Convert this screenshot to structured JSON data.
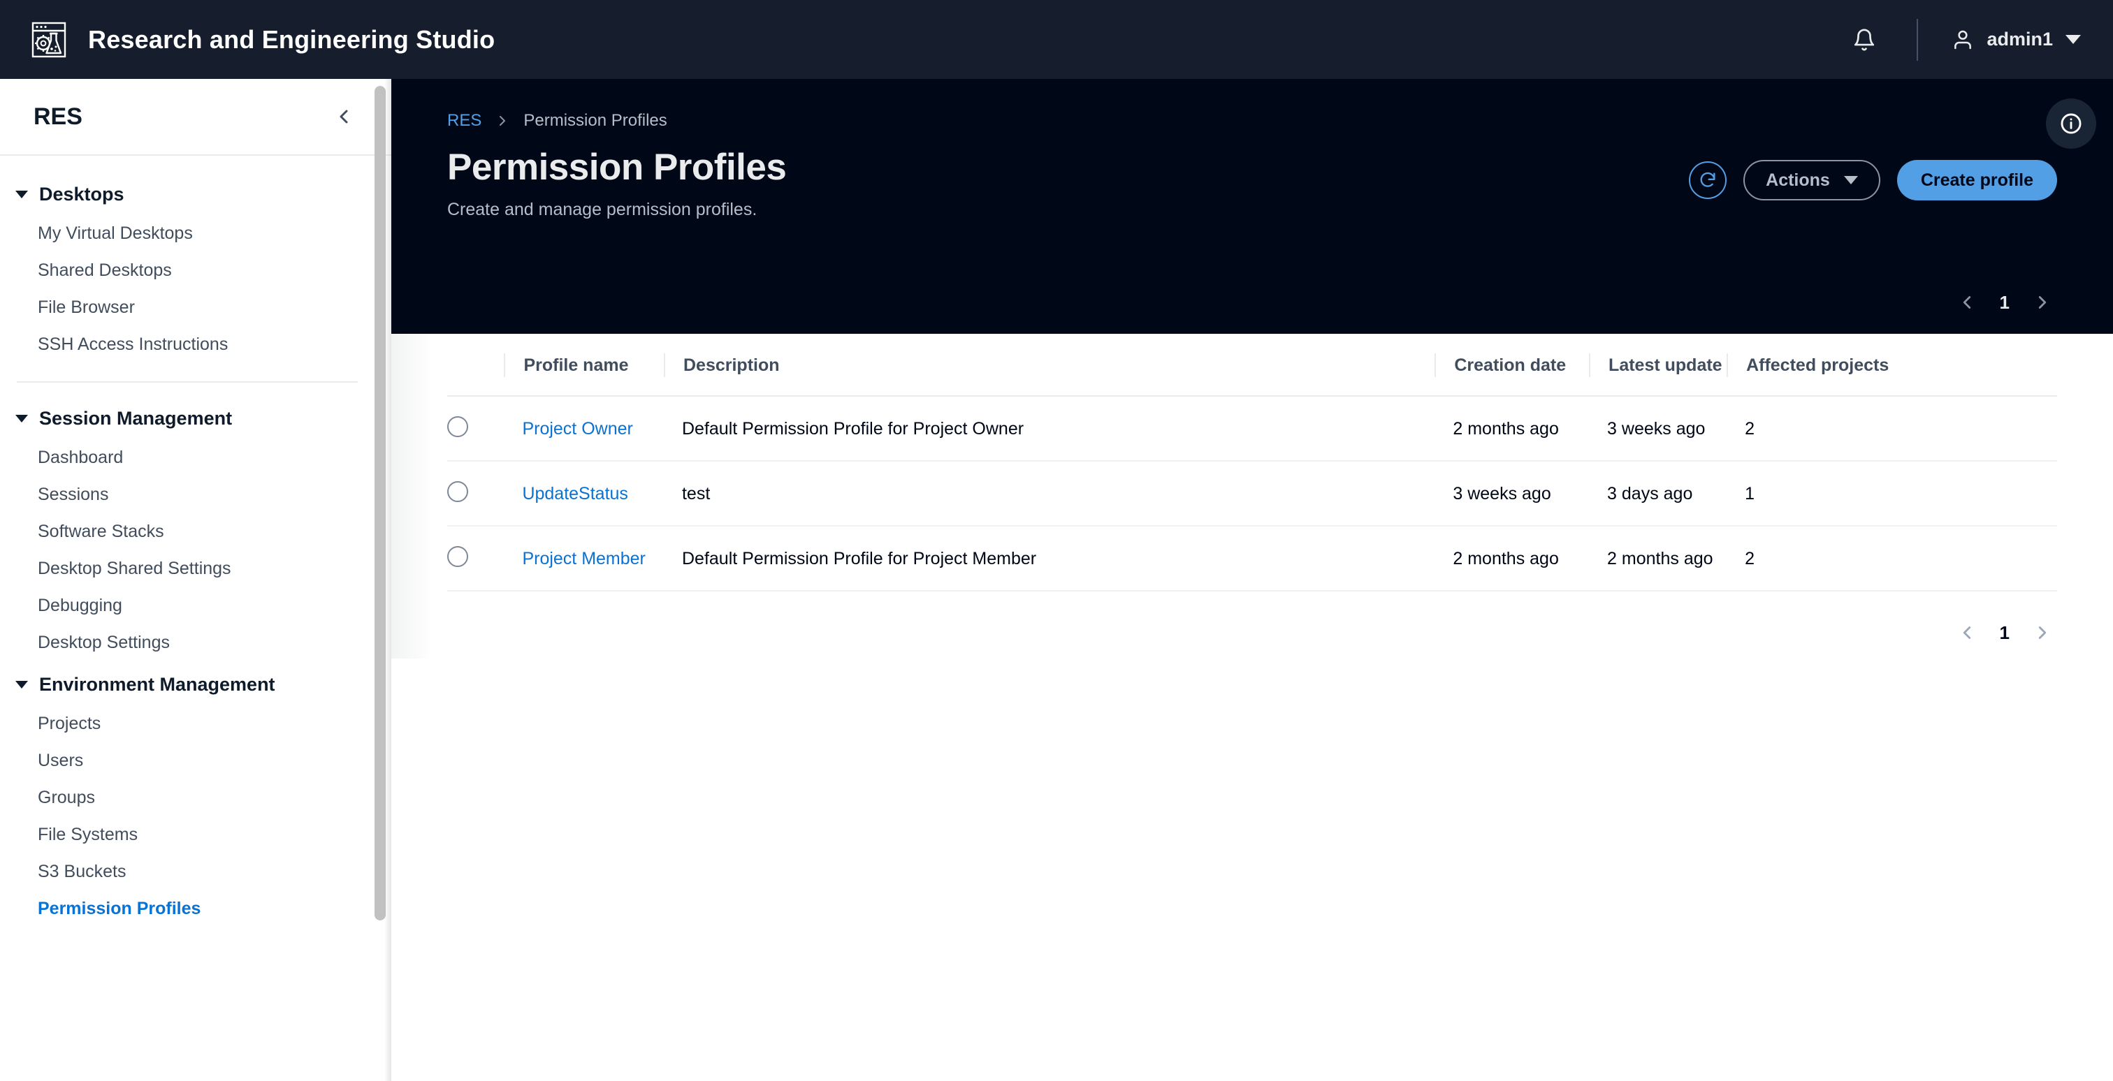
{
  "topbar": {
    "brand_title": "Research and Engineering Studio",
    "logo_icon": "flask-gear-window-logo-icon",
    "notifications_icon": "bell-icon",
    "user_icon": "user-icon",
    "user_name": "admin1",
    "user_caret_icon": "caret-down-icon"
  },
  "sidebar": {
    "title": "RES",
    "collapse_icon": "chevron-left-icon",
    "groups": [
      {
        "label": "Desktops",
        "expanded_icon": "triangle-down-icon",
        "items": [
          {
            "label": "My Virtual Desktops",
            "active": false
          },
          {
            "label": "Shared Desktops",
            "active": false
          },
          {
            "label": "File Browser",
            "active": false
          },
          {
            "label": "SSH Access Instructions",
            "active": false
          }
        ]
      },
      {
        "label": "Session Management",
        "expanded_icon": "triangle-down-icon",
        "items": [
          {
            "label": "Dashboard",
            "active": false
          },
          {
            "label": "Sessions",
            "active": false
          },
          {
            "label": "Software Stacks",
            "active": false
          },
          {
            "label": "Desktop Shared Settings",
            "active": false
          },
          {
            "label": "Debugging",
            "active": false
          },
          {
            "label": "Desktop Settings",
            "active": false
          }
        ]
      },
      {
        "label": "Environment Management",
        "expanded_icon": "triangle-down-icon",
        "items": [
          {
            "label": "Projects",
            "active": false
          },
          {
            "label": "Users",
            "active": false
          },
          {
            "label": "Groups",
            "active": false
          },
          {
            "label": "File Systems",
            "active": false
          },
          {
            "label": "S3 Buckets",
            "active": false
          },
          {
            "label": "Permission Profiles",
            "active": true
          }
        ]
      }
    ]
  },
  "main": {
    "breadcrumb": {
      "root": "RES",
      "separator_icon": "chevron-right-icon",
      "current": "Permission Profiles"
    },
    "page_title": "Permission Profiles",
    "page_subtitle": "Create and manage permission profiles.",
    "toolbar": {
      "refresh_icon": "refresh-icon",
      "refresh_label": "",
      "actions_label": "Actions",
      "actions_caret_icon": "caret-down-icon",
      "create_label": "Create profile"
    },
    "info_icon": "info-circle-icon",
    "pagination_top": {
      "prev_icon": "chevron-left-icon",
      "page": "1",
      "next_icon": "chevron-right-icon"
    },
    "pagination_bottom": {
      "prev_icon": "chevron-left-icon",
      "page": "1",
      "next_icon": "chevron-right-icon"
    },
    "table": {
      "columns": [
        "Profile name",
        "Description",
        "Creation date",
        "Latest update",
        "Affected projects"
      ],
      "rows": [
        {
          "selected": false,
          "profile_name": "Project Owner",
          "description": "Default Permission Profile for Project Owner",
          "creation_date": "2 months ago",
          "latest_update": "3 weeks ago",
          "affected_projects": "2"
        },
        {
          "selected": false,
          "profile_name": "UpdateStatus",
          "description": "test",
          "creation_date": "3 weeks ago",
          "latest_update": "3 days ago",
          "affected_projects": "1"
        },
        {
          "selected": false,
          "profile_name": "Project Member",
          "description": "Default Permission Profile for Project Member",
          "creation_date": "2 months ago",
          "latest_update": "2 months ago",
          "affected_projects": "2"
        }
      ]
    }
  },
  "colors": {
    "topbar_bg": "#161e2d",
    "hero_bg": "#000716",
    "accent_blue": "#539fe5",
    "link_blue": "#0972d3",
    "text_dark": "#000716",
    "muted": "#b6bec9"
  }
}
